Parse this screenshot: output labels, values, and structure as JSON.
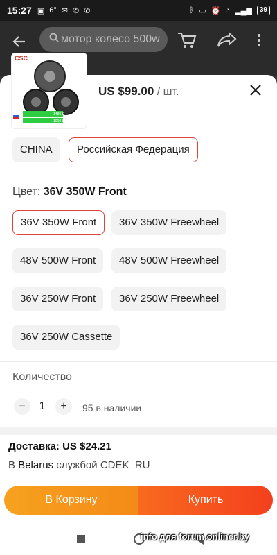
{
  "status_bar": {
    "time": "15:27",
    "left_icons": [
      "6°"
    ],
    "battery": "39"
  },
  "header": {
    "search_text": "мотор колесо 500w"
  },
  "product": {
    "brand_logo": "CSC",
    "price": "US $99.00",
    "unit": " / шт.",
    "flag_label": "",
    "promo_lines": [
      "1480 ₽",
      "1000 ₽"
    ]
  },
  "ship_from": {
    "options": [
      "CHINA",
      "Российская Федерация"
    ],
    "selected": "Российская Федерация"
  },
  "color": {
    "label": "Цвет: ",
    "selected_value": "36V 350W Front",
    "options": [
      "36V 350W Front",
      "36V 350W Freewheel",
      "48V 500W Front",
      "48V 500W Freewheel",
      "36V 250W Front",
      "36V 250W Freewheel",
      "36V 250W Cassette"
    ]
  },
  "quantity": {
    "label": "Количество",
    "minus": "−",
    "value": "1",
    "plus": "+",
    "stock": "95 в наличии"
  },
  "delivery": {
    "cost": "Доставка: US $24.21",
    "prefix": "В ",
    "country": "Belarus",
    "suffix": " службой CDEK_RU"
  },
  "actions": {
    "cart": "В Корзину",
    "buy": "Купить"
  },
  "watermark": "info для forum.onliner.by",
  "colors": {
    "accent_red": "#e0433a",
    "cart_orange": "#f59a1c",
    "buy_orange": "#f5501d"
  }
}
